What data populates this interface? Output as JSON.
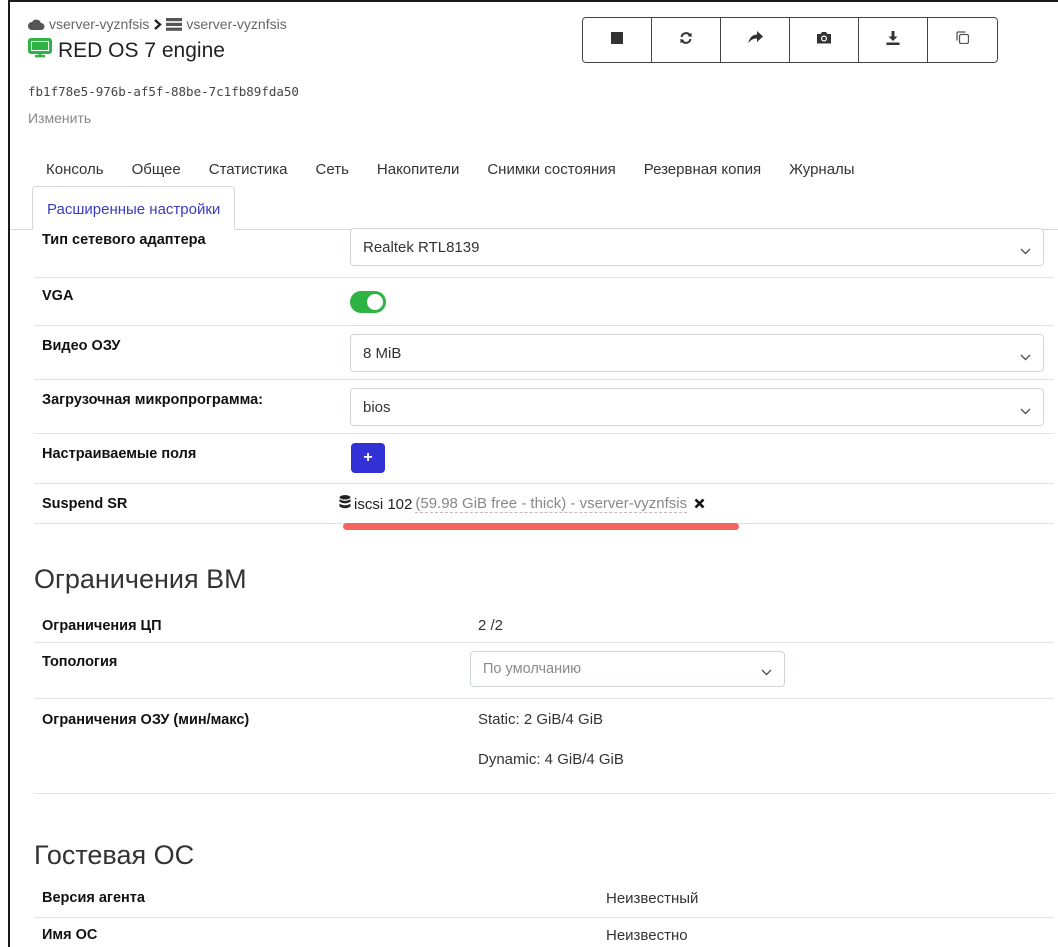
{
  "breadcrumb": {
    "pool": "vserver-vyznfsis",
    "host": "vserver-vyznfsis"
  },
  "vm": {
    "name": "RED OS 7 engine",
    "uuid": "fb1f78e5-976b-af5f-88be-7c1fb89fda50",
    "edit_label": "Изменить"
  },
  "toolbar": [
    "stop-icon",
    "restart-icon",
    "migrate-icon",
    "snapshot-icon",
    "export-icon",
    "copy-icon"
  ],
  "tabs": [
    "Консоль",
    "Общее",
    "Статистика",
    "Сеть",
    "Накопители",
    "Снимки состояния",
    "Резервная копия",
    "Журналы"
  ],
  "active_tab": "Расширенные настройки",
  "settings": {
    "nic_label": "Тип сетевого адаптера",
    "nic_value": "Realtek RTL8139",
    "vga_label": "VGA",
    "vga_on": true,
    "vram_label": "Видео ОЗУ",
    "vram_value": "8 MiB",
    "firmware_label": "Загрузочная микропрограмма:",
    "firmware_value": "bios",
    "custom_fields_label": "Настраиваемые поля",
    "custom_fields_add": "+",
    "suspend_label": "Suspend SR",
    "suspend_sr_name": "iscsi 102",
    "suspend_sr_detail": "(59.98 GiB free - thick) - vserver-vyznfsis"
  },
  "limits": {
    "title": "Ограничения ВМ",
    "cpu_label": "Ограничения ЦП",
    "cpu_value": "2 /2",
    "topology_label": "Топология",
    "topology_placeholder": "По умолчанию",
    "ram_label": "Ограничения ОЗУ (мин/макс)",
    "ram_static": "Static: 2 GiB/4 GiB",
    "ram_dynamic": "Dynamic: 4 GiB/4 GiB"
  },
  "guest": {
    "title": "Гостевая ОС",
    "agent_label": "Версия агента",
    "agent_value": "Неизвестный",
    "os_label": "Имя ОС",
    "os_value": "Неизвестно"
  },
  "colors": {
    "accent": "#3131d6",
    "toggle_on": "#2fb344",
    "vm_icon": "#2fb344",
    "annotation": "#f4534e"
  }
}
